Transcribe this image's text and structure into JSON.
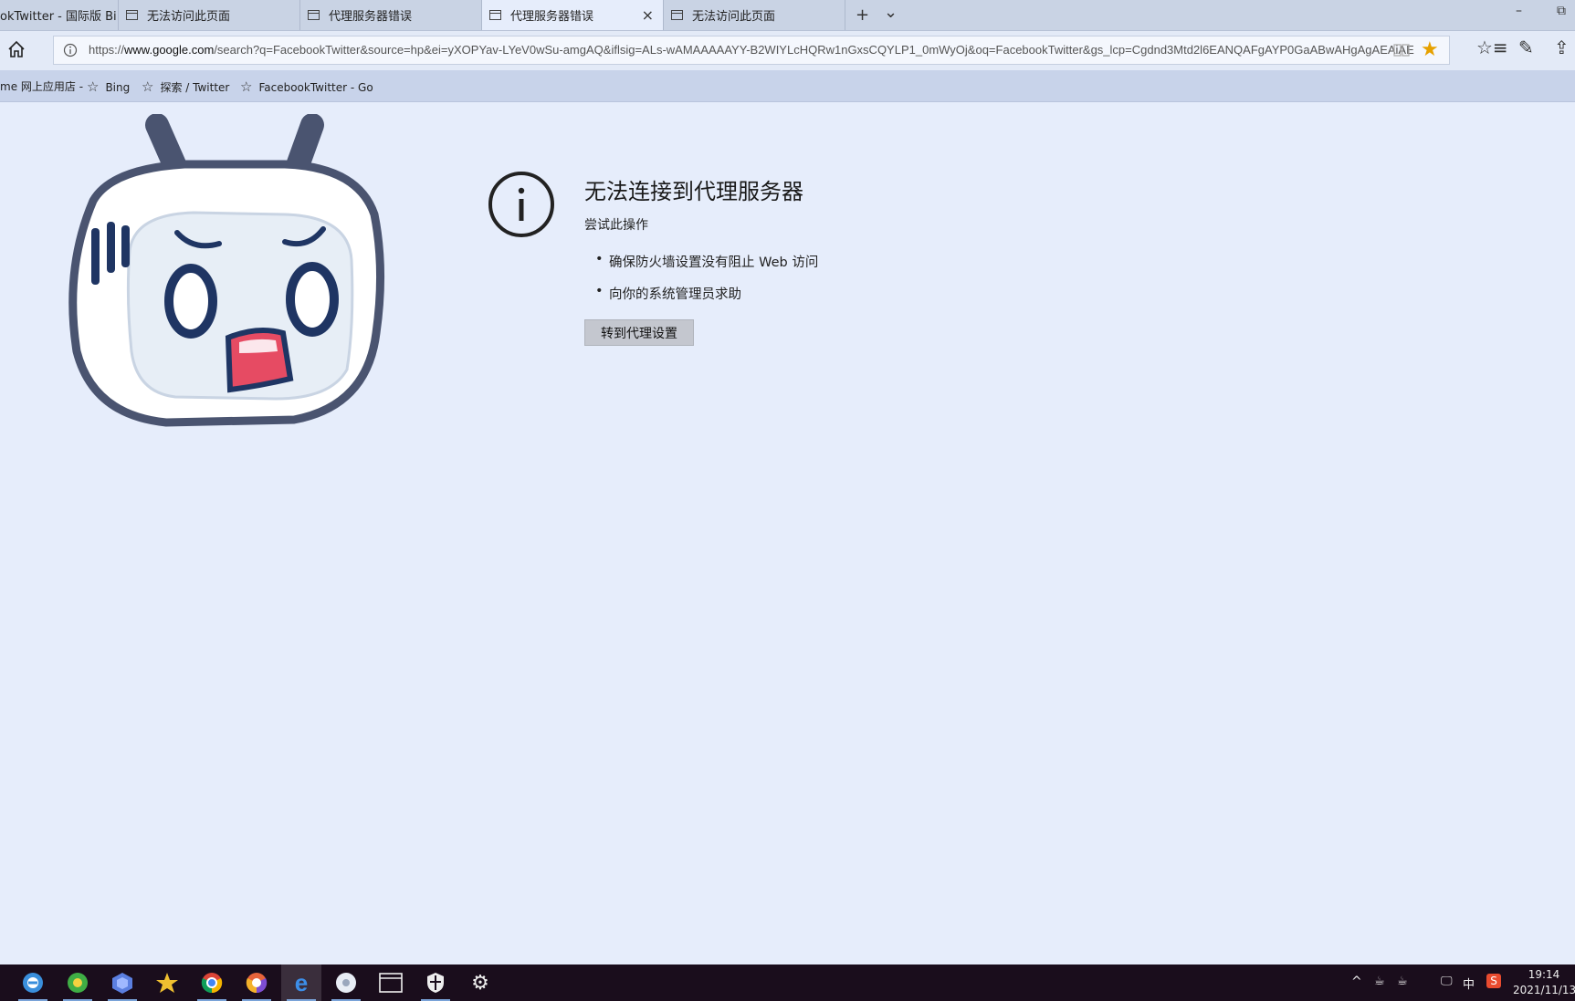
{
  "tabs": [
    {
      "title": "okTwitter - 国际版 Bi",
      "active": false
    },
    {
      "title": "无法访问此页面",
      "active": false
    },
    {
      "title": "代理服务器错误",
      "active": false
    },
    {
      "title": "代理服务器错误",
      "active": true,
      "close": "×"
    },
    {
      "title": "无法访问此页面",
      "active": false
    }
  ],
  "tab_controls": {
    "new_tab": "+",
    "tab_list": "⌄"
  },
  "window_controls": {
    "minimize": "–",
    "restore": "⧉"
  },
  "address_bar": {
    "url_prefix": "https://",
    "url_host": "www.google.com",
    "url_rest": "/search?q=FacebookTwitter&source=hp&ei=yXOPYav-LYeV0wSu-amgAQ&iflsig=ALs-wAMAAAAAYY-B2WIYLcHQRw1nGxsCQYLP1_0mWyOj&oq=FacebookTwitter&gs_lcp=Cgdnd3Mtd2l6EANQAFgAYP0GaABwAHgAgAEAiAE"
  },
  "toolbar": {
    "favorites_icon": "☆≡",
    "pen_icon": "✎",
    "share_icon": "⇪"
  },
  "favorites": [
    {
      "label": "me 网上应用店 -",
      "has_star": false
    },
    {
      "label": "Bing",
      "has_star": true
    },
    {
      "label": "探索 / Twitter",
      "has_star": true
    },
    {
      "label": "FacebookTwitter - Go",
      "has_star": true
    }
  ],
  "error": {
    "title": "无法连接到代理服务器",
    "subtitle": "尝试此操作",
    "suggestions": [
      "确保防火墙设置没有阻止 Web 访问",
      "向你的系统管理员求助"
    ],
    "button": "转到代理设置"
  },
  "taskbar": {
    "apps": [
      "edge-legacy-icon",
      "360-browser-icon",
      "app-store-icon",
      "favorites-app-icon",
      "chrome-icon",
      "chromium-icon",
      "edge-icon",
      "web-app-icon",
      "window-icon",
      "security-icon",
      "settings-icon"
    ],
    "tray": {
      "chevron": "^",
      "ime": "中"
    },
    "time": "19:14",
    "date": "2021/11/13"
  },
  "colors": {
    "accent_star": "#e6a100",
    "page_bg": "#e6edfb",
    "taskbar_bg": "#1a0d1c"
  }
}
